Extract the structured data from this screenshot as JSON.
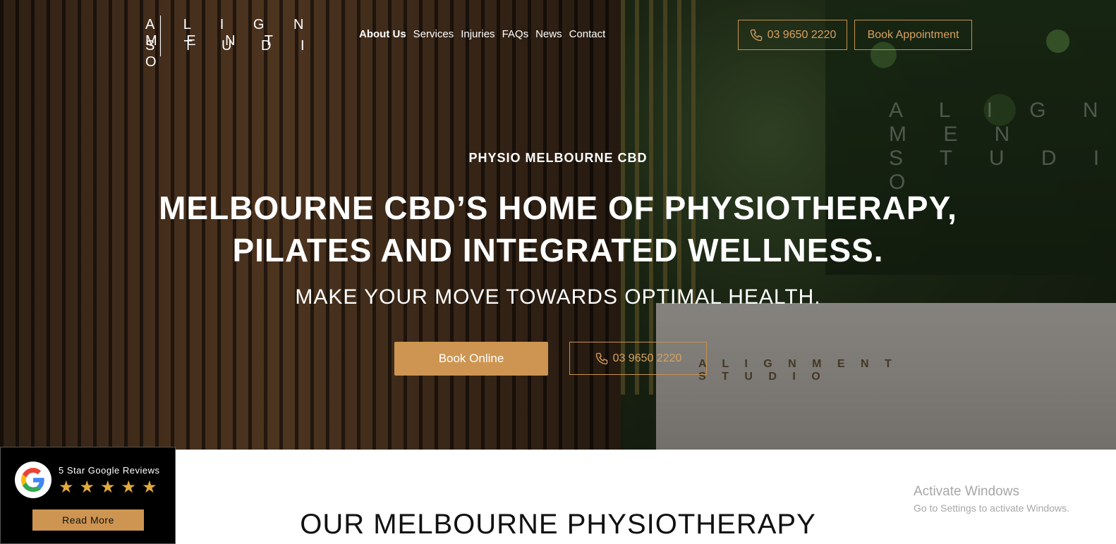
{
  "brand": {
    "logo_line1": "A L I G N M E N T",
    "logo_line2": "S T U D I O"
  },
  "nav": {
    "items": [
      "About Us",
      "Services",
      "Injuries",
      "FAQs",
      "News",
      "Contact"
    ],
    "active": "About Us"
  },
  "header_actions": {
    "phone_label": "03 9650 2220",
    "book_label": "Book Appointment"
  },
  "hero": {
    "eyebrow": "PHYSIO MELBOURNE CBD",
    "headline": "MELBOURNE CBD’S HOME OF PHYSIOTHERAPY, PILATES AND INTEGRATED WELLNESS.",
    "subhead": "MAKE YOUR MOVE TOWARDS OPTIMAL HEALTH.",
    "primary_cta": "Book Online",
    "secondary_cta": "03 9650 2220",
    "wall_wordmark_line1": "A L I G N M E N",
    "wall_wordmark_line2": "S T U D I O",
    "desk_wordmark_line1": "A L I G N M E N T",
    "desk_wordmark_line2": "S T U D I O"
  },
  "section": {
    "title": "OUR MELBOURNE PHYSIOTHERAPY"
  },
  "google_widget": {
    "title": "5 Star Google Reviews",
    "stars": 5,
    "read_more": "Read More"
  },
  "windows_watermark": {
    "line1": "Activate Windows",
    "line2": "Go to Settings to activate Windows."
  },
  "colors": {
    "accent_gold": "#cd9551",
    "star": "#e2a93b"
  },
  "icons": [
    "phone-icon",
    "google-logo-icon",
    "star-icon"
  ]
}
